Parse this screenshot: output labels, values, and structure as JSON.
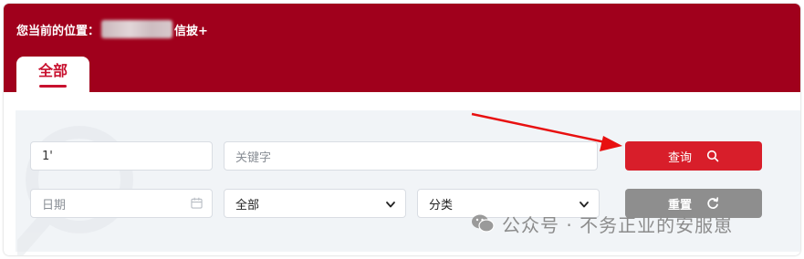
{
  "breadcrumb": {
    "prefix": "您当前的位置：",
    "current": "信披+"
  },
  "tabs": [
    {
      "label": "全部",
      "active": true
    }
  ],
  "filters": {
    "number_value": "1'",
    "keyword_placeholder": "关键字",
    "date_placeholder": "日期",
    "scope_select": "全部",
    "category_select": "分类"
  },
  "buttons": {
    "search": "查询",
    "reset": "重置"
  },
  "watermark": {
    "text": "公众号 · 不务正业的安服崽"
  },
  "colors": {
    "header": "#a0001c",
    "accent": "#c8102e",
    "search_button": "#d81e2a",
    "reset_button": "#8e8e8e",
    "panel": "#f1f4f7"
  },
  "icons": {
    "date": "calendar-icon",
    "search": "search-icon",
    "reset": "refresh-icon",
    "select": "chevron-down-icon",
    "watermark": "wechat-icon"
  }
}
